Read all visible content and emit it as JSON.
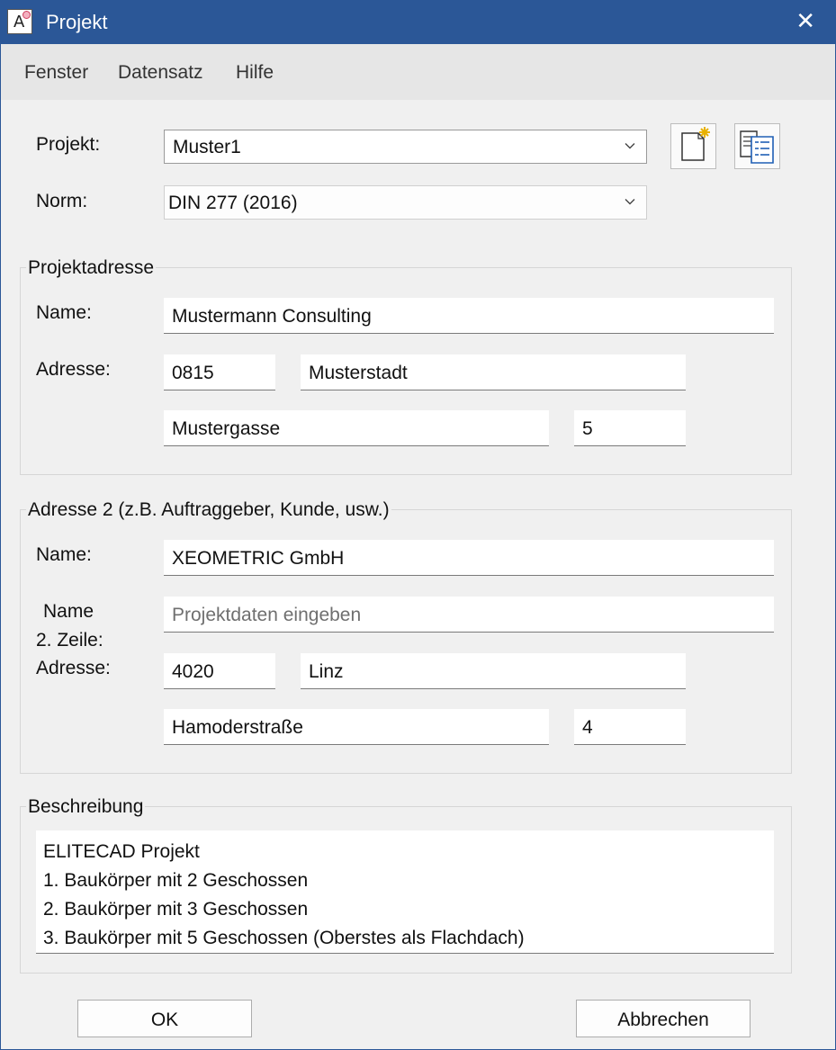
{
  "window": {
    "title": "Projekt"
  },
  "menu": {
    "items": [
      "Fenster",
      "Datensatz",
      "Hilfe"
    ]
  },
  "project": {
    "label": "Projekt:",
    "value": "Muster1"
  },
  "norm": {
    "label": "Norm:",
    "value": "DIN 277 (2016)"
  },
  "project_address": {
    "title": "Projektadresse",
    "name_label": "Name:",
    "name": "Mustermann Consulting",
    "address_label": "Adresse:",
    "zip": "0815",
    "city": "Musterstadt",
    "street": "Mustergasse",
    "number": "5"
  },
  "address2": {
    "title": "Adresse 2 (z.B. Auftraggeber, Kunde, usw.)",
    "name_label": "Name:",
    "name": "XEOMETRIC GmbH",
    "name2_label_line1": "Name",
    "name2_label_line2": "2. Zeile:",
    "name2_placeholder": "Projektdaten eingeben",
    "address_label": "Adresse:",
    "zip": "4020",
    "city": "Linz",
    "street": "Hamoderstraße",
    "number": "4"
  },
  "description": {
    "title": "Beschreibung",
    "lines": [
      "ELITECAD Projekt",
      "1. Baukörper mit 2 Geschossen",
      "2. Baukörper mit 3 Geschossen",
      "3. Baukörper mit 5 Geschossen (Oberstes als Flachdach)"
    ]
  },
  "buttons": {
    "ok": "OK",
    "cancel": "Abbrechen"
  },
  "icons": {
    "app": "app-icon",
    "close": "close-icon",
    "new_project": "new-document-icon",
    "project_list": "list-icon",
    "dropdown": "chevron-down-icon"
  },
  "colors": {
    "titlebar": "#2b5797",
    "menubar": "#e6e6e6",
    "background": "#f0f0f0"
  }
}
